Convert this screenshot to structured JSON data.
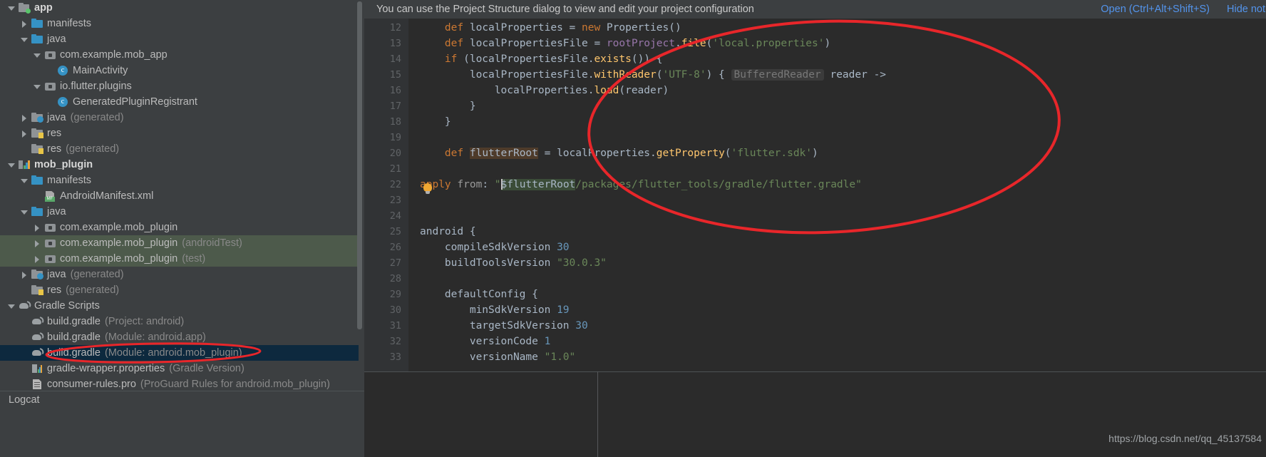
{
  "notification": {
    "message": "You can use the Project Structure dialog to view and edit your project configuration",
    "open_label": "Open (Ctrl+Alt+Shift+S)",
    "hide_label": "Hide notification"
  },
  "logcat": {
    "label": "Logcat"
  },
  "watermark": {
    "text": "https://blog.csdn.net/qq_45137584"
  },
  "tree": {
    "items": [
      {
        "indent": 0,
        "twisty": "down",
        "icon": "app-module-icon",
        "label": "app",
        "sub": "",
        "bold": true,
        "state": ""
      },
      {
        "indent": 1,
        "twisty": "right",
        "icon": "folder-icon",
        "label": "manifests",
        "sub": "",
        "bold": false,
        "state": ""
      },
      {
        "indent": 1,
        "twisty": "down",
        "icon": "folder-icon",
        "label": "java",
        "sub": "",
        "bold": false,
        "state": ""
      },
      {
        "indent": 2,
        "twisty": "down",
        "icon": "package-icon",
        "label": "com.example.mob_app",
        "sub": "",
        "bold": false,
        "state": ""
      },
      {
        "indent": 3,
        "twisty": "none",
        "icon": "java-class-icon",
        "label": "MainActivity",
        "sub": "",
        "bold": false,
        "state": ""
      },
      {
        "indent": 2,
        "twisty": "down",
        "icon": "package-icon",
        "label": "io.flutter.plugins",
        "sub": "",
        "bold": false,
        "state": ""
      },
      {
        "indent": 3,
        "twisty": "none",
        "icon": "java-class-icon",
        "label": "GeneratedPluginRegistrant",
        "sub": "",
        "bold": false,
        "state": ""
      },
      {
        "indent": 1,
        "twisty": "right",
        "icon": "folder-generated-icon",
        "label": "java",
        "sub": "(generated)",
        "bold": false,
        "state": ""
      },
      {
        "indent": 1,
        "twisty": "right",
        "icon": "folder-res-icon",
        "label": "res",
        "sub": "",
        "bold": false,
        "state": ""
      },
      {
        "indent": 1,
        "twisty": "none",
        "icon": "folder-res-icon",
        "label": "res",
        "sub": "(generated)",
        "bold": false,
        "state": ""
      },
      {
        "indent": 0,
        "twisty": "down",
        "icon": "module-icon",
        "label": "mob_plugin",
        "sub": "",
        "bold": true,
        "state": ""
      },
      {
        "indent": 1,
        "twisty": "down",
        "icon": "folder-icon",
        "label": "manifests",
        "sub": "",
        "bold": false,
        "state": ""
      },
      {
        "indent": 2,
        "twisty": "none",
        "icon": "android-manifest-icon",
        "label": "AndroidManifest.xml",
        "sub": "",
        "bold": false,
        "state": ""
      },
      {
        "indent": 1,
        "twisty": "down",
        "icon": "folder-icon",
        "label": "java",
        "sub": "",
        "bold": false,
        "state": ""
      },
      {
        "indent": 2,
        "twisty": "right",
        "icon": "package-icon",
        "label": "com.example.mob_plugin",
        "sub": "",
        "bold": false,
        "state": ""
      },
      {
        "indent": 2,
        "twisty": "right",
        "icon": "package-icon",
        "label": "com.example.mob_plugin",
        "sub": "(androidTest)",
        "bold": false,
        "state": "sel-green"
      },
      {
        "indent": 2,
        "twisty": "right",
        "icon": "package-icon",
        "label": "com.example.mob_plugin",
        "sub": "(test)",
        "bold": false,
        "state": "sel-green"
      },
      {
        "indent": 1,
        "twisty": "right",
        "icon": "folder-generated-icon",
        "label": "java",
        "sub": "(generated)",
        "bold": false,
        "state": ""
      },
      {
        "indent": 1,
        "twisty": "none",
        "icon": "folder-res-icon",
        "label": "res",
        "sub": "(generated)",
        "bold": false,
        "state": ""
      },
      {
        "indent": 0,
        "twisty": "down",
        "icon": "gradle-icon",
        "label": "Gradle Scripts",
        "sub": "",
        "bold": false,
        "state": ""
      },
      {
        "indent": 1,
        "twisty": "none",
        "icon": "gradle-icon",
        "label": "build.gradle",
        "sub": "(Project: android)",
        "bold": false,
        "state": ""
      },
      {
        "indent": 1,
        "twisty": "none",
        "icon": "gradle-icon",
        "label": "build.gradle",
        "sub": "(Module: android.app)",
        "bold": false,
        "state": ""
      },
      {
        "indent": 1,
        "twisty": "none",
        "icon": "gradle-icon",
        "label": "build.gradle",
        "sub": "(Module: android.mob_plugin)",
        "bold": false,
        "state": "sel-blue"
      },
      {
        "indent": 1,
        "twisty": "none",
        "icon": "properties-icon",
        "label": "gradle-wrapper.properties",
        "sub": "(Gradle Version)",
        "bold": false,
        "state": ""
      },
      {
        "indent": 1,
        "twisty": "none",
        "icon": "proguard-file-icon",
        "label": "consumer-rules.pro",
        "sub": "(ProGuard Rules for android.mob_plugin)",
        "bold": false,
        "state": ""
      }
    ]
  },
  "editor": {
    "first_line_number": 12,
    "line_numbers": [
      12,
      13,
      14,
      15,
      16,
      17,
      18,
      19,
      20,
      21,
      22,
      23,
      24,
      25,
      26,
      27,
      28,
      29,
      30,
      31,
      32,
      33
    ],
    "lines": [
      {
        "n": 12,
        "text": "    def localProperties = new Properties()"
      },
      {
        "n": 13,
        "text": "    def localPropertiesFile = rootProject.file('local.properties')"
      },
      {
        "n": 14,
        "text": "    if (localPropertiesFile.exists()) {"
      },
      {
        "n": 15,
        "text": "        localPropertiesFile.withReader('UTF-8') { BufferedReader reader ->"
      },
      {
        "n": 16,
        "text": "            localProperties.load(reader)"
      },
      {
        "n": 17,
        "text": "        }"
      },
      {
        "n": 18,
        "text": "    }"
      },
      {
        "n": 19,
        "text": ""
      },
      {
        "n": 20,
        "text": "    def flutterRoot = localProperties.getProperty('flutter.sdk')"
      },
      {
        "n": 21,
        "text": ""
      },
      {
        "n": 22,
        "text": "apply from: \"$flutterRoot/packages/flutter_tools/gradle/flutter.gradle\""
      },
      {
        "n": 23,
        "text": ""
      },
      {
        "n": 24,
        "text": ""
      },
      {
        "n": 25,
        "text": "android {"
      },
      {
        "n": 26,
        "text": "    compileSdkVersion 30"
      },
      {
        "n": 27,
        "text": "    buildToolsVersion \"30.0.3\""
      },
      {
        "n": 28,
        "text": ""
      },
      {
        "n": 29,
        "text": "    defaultConfig {"
      },
      {
        "n": 30,
        "text": "        minSdkVersion 19"
      },
      {
        "n": 31,
        "text": "        targetSdkVersion 30"
      },
      {
        "n": 32,
        "text": "        versionCode 1"
      },
      {
        "n": 33,
        "text": "        versionName \"1.0\""
      }
    ],
    "inlay_hint": "BufferedReader",
    "intention_bulb": "lightbulb-icon"
  },
  "colors": {
    "accent_link": "#5394ec",
    "annotation": "#e8262a",
    "selection_blue": "#0d293e",
    "selection_green": "#4d5a4b",
    "editor_bg": "#2b2b2b",
    "panel_bg": "#3c3f41"
  }
}
